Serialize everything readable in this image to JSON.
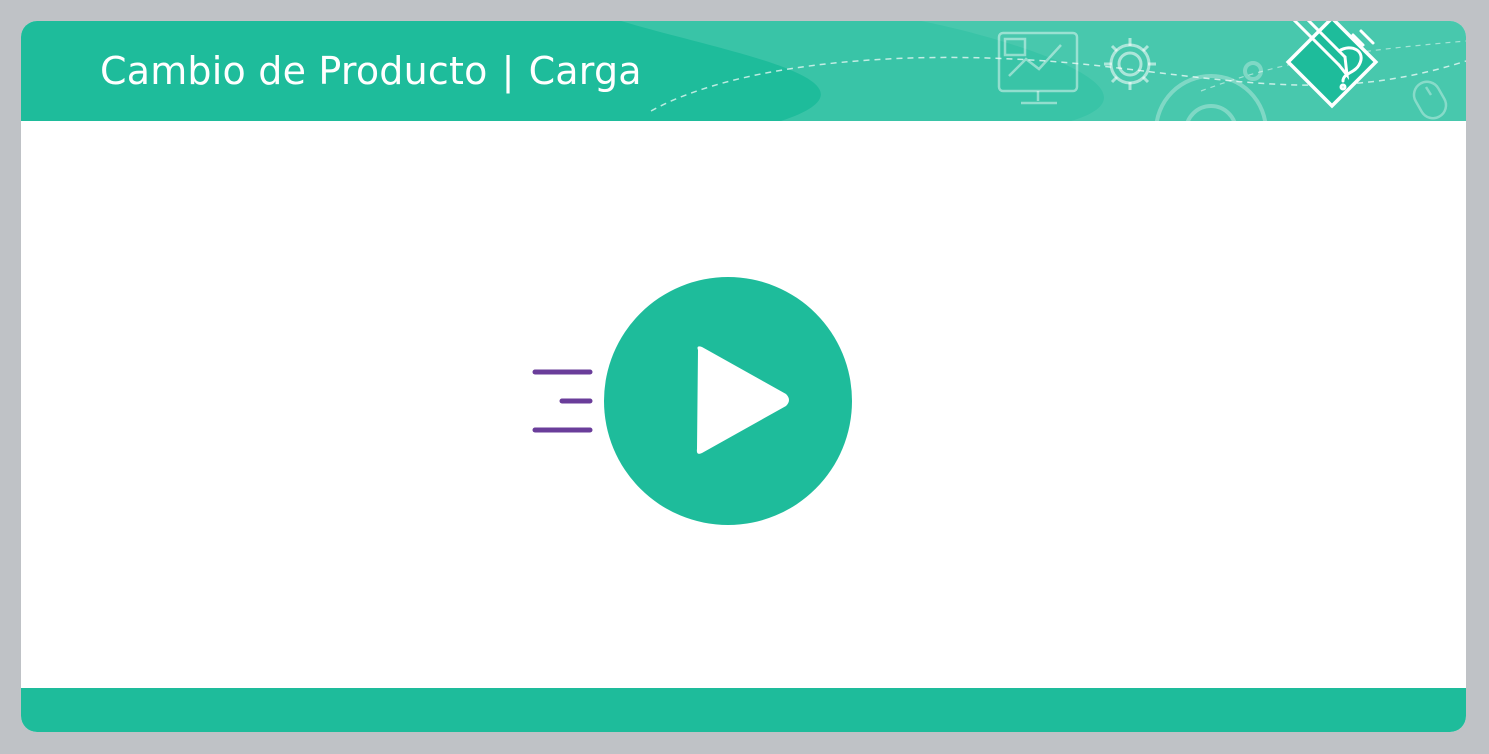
{
  "header": {
    "title_main": "Cambio de Producto",
    "title_separator": "|",
    "title_sub": "Carga",
    "decorative_icons": [
      "monitor-chart-icon",
      "gear-icon",
      "large-gear-icon",
      "pencil-document-icon",
      "mouse-icon"
    ]
  },
  "player": {
    "play_icon": "play-icon",
    "motion_lines_icon": "motion-lines-icon"
  },
  "colors": {
    "accent": "#1ebc9b",
    "motion_lines": "#6a3d9a",
    "background": "#bfc2c6",
    "panel": "#ffffff"
  }
}
